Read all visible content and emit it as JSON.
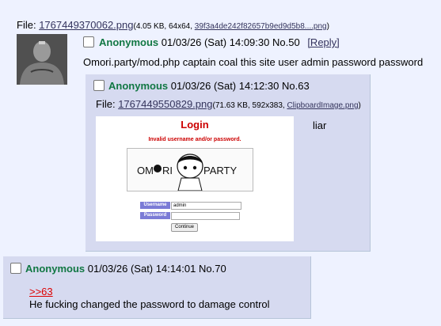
{
  "op": {
    "file_label": "File:",
    "file_name": "1767449370062.png",
    "file_info_pre": "(4.05 KB, 64x64, ",
    "file_orig_name": "39f3a4de242f82657b9ed9d5b8....png",
    "file_info_post": ")",
    "name": "Anonymous",
    "datetime": "01/03/26 (Sat) 14:09:30",
    "post_no": "No.50",
    "reply_link": "[Reply]",
    "comment": "Omori.party/mod.php captain coal this site user admin password password"
  },
  "reply1": {
    "name": "Anonymous",
    "datetime": "01/03/26 (Sat) 14:12:30",
    "post_no": "No.63",
    "file_label": "File:",
    "file_name": "1767449550829.png",
    "file_info_pre": "(71.63 KB, 592x383, ",
    "file_orig_name": "ClipboardImage.png",
    "file_info_post": ")",
    "comment": "liar",
    "screenshot": {
      "title": "Login",
      "error": "Invalid username and/or password.",
      "logo_left": "OM",
      "logo_mid": "RI",
      "logo_right": "PARTY",
      "username_label": "Username",
      "username_value": "admin",
      "password_label": "Password",
      "continue_label": "Continue"
    }
  },
  "reply2": {
    "name": "Anonymous",
    "datetime": "01/03/26 (Sat) 14:14:01",
    "post_no": "No.70",
    "quote": ">>63",
    "comment": "He fucking changed the password to damage control"
  },
  "colors": {
    "background": "#eef2ff",
    "reply_bg": "#d6daf0",
    "name": "#117743",
    "link": "#34345c",
    "quote_link": "#dd0000",
    "error_red": "#cc0000"
  }
}
